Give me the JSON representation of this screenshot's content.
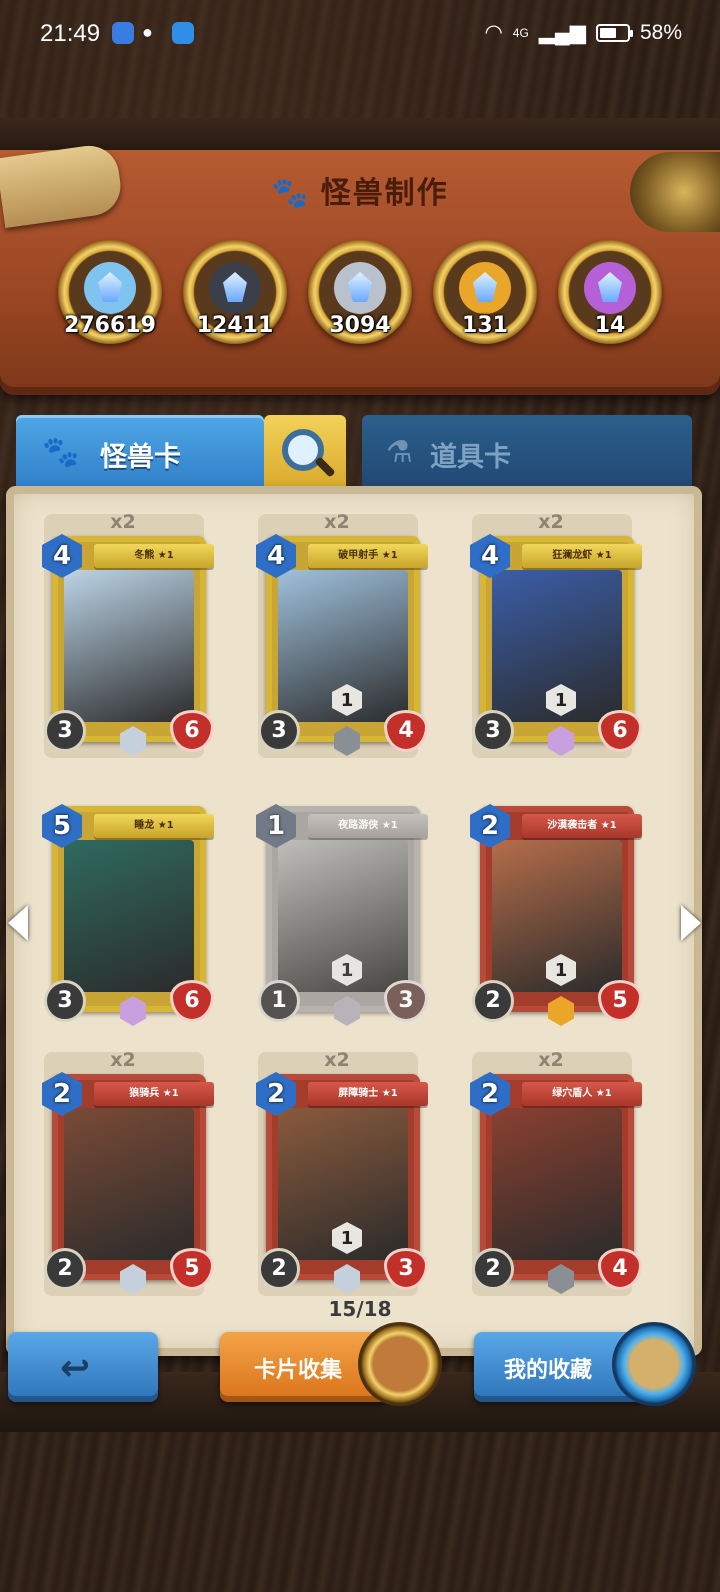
{
  "status_bar": {
    "time": "21:49",
    "network": "4G",
    "battery": "58%"
  },
  "header": {
    "title": "怪兽制作"
  },
  "currencies": [
    {
      "name": "essence-bottle",
      "value": "276619",
      "color": "#7fc4ee"
    },
    {
      "name": "dark-crystal",
      "value": "12411",
      "color": "#3b3f4a"
    },
    {
      "name": "silver-crystal",
      "value": "3094",
      "color": "#b9c2cc"
    },
    {
      "name": "gold-crystal",
      "value": "131",
      "color": "#e9a628"
    },
    {
      "name": "rainbow-crystal",
      "value": "14",
      "color": "#b660d8"
    }
  ],
  "tabs": {
    "monster": "怪兽卡",
    "item": "道具卡"
  },
  "cards": [
    {
      "count": "x2",
      "name": "冬熊 ★1",
      "cost": "4",
      "atk": "3",
      "hp": "6",
      "frame": "gold",
      "art": "#bcd4e6",
      "rarity": "#c6d0dc"
    },
    {
      "count": "x2",
      "name": "破甲射手 ★1",
      "cost": "4",
      "atk": "3",
      "hp": "4",
      "frame": "gold",
      "art": "#9fc1dc",
      "rarity": "#8a8f96",
      "ability": "1"
    },
    {
      "count": "x2",
      "name": "狂澜龙虾 ★1",
      "cost": "4",
      "atk": "3",
      "hp": "6",
      "frame": "gold",
      "art": "#3a5ea8",
      "rarity": "#c8a0e0",
      "ability": "1"
    },
    {
      "count": "",
      "name": "睡龙 ★1",
      "cost": "5",
      "atk": "3",
      "hp": "6",
      "frame": "gold",
      "art": "#2f6a5e",
      "rarity": "#c8a0e0"
    },
    {
      "count": "",
      "name": "夜路游侠 ★1",
      "cost": "1",
      "atk": "1",
      "hp": "3",
      "frame": "gray",
      "art": "#b8b8b8",
      "rarity": "#c8a0e0",
      "ability": "1"
    },
    {
      "count": "",
      "name": "沙漠袭击者 ★1",
      "cost": "2",
      "atk": "2",
      "hp": "5",
      "frame": "red",
      "art": "#b56d4a",
      "rarity": "#e9a628",
      "ability": "1"
    },
    {
      "count": "x2",
      "name": "狼骑兵 ★1",
      "cost": "2",
      "atk": "2",
      "hp": "5",
      "frame": "red",
      "art": "#7a4a36",
      "rarity": "#c6d0dc"
    },
    {
      "count": "x2",
      "name": "屏障骑士 ★1",
      "cost": "2",
      "atk": "2",
      "hp": "3",
      "frame": "red",
      "art": "#8a5a3c",
      "rarity": "#c6d0dc",
      "ability": "1"
    },
    {
      "count": "x2",
      "name": "绿穴盾人 ★1",
      "cost": "2",
      "atk": "2",
      "hp": "4",
      "frame": "red",
      "art": "#8a4030",
      "rarity": "#8a8f96"
    }
  ],
  "pagination": {
    "label": "15/18"
  },
  "buttons": {
    "collect": "卡片收集",
    "mine": "我的收藏"
  }
}
